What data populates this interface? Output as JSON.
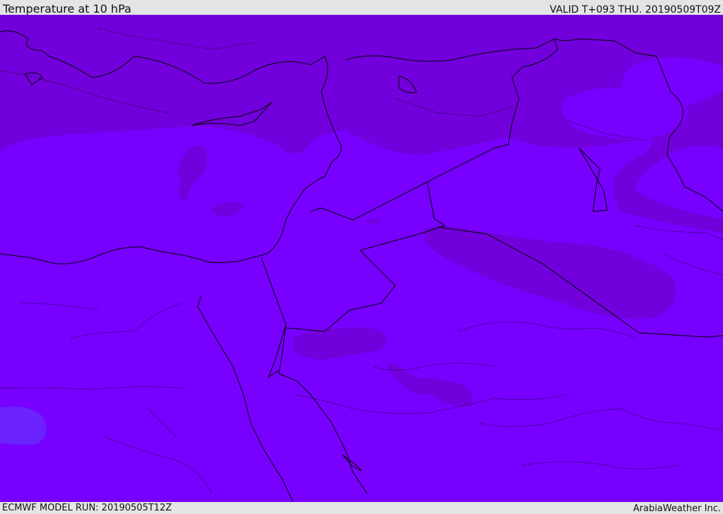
{
  "header": {
    "title": "Temperature at 10 hPa",
    "valid": "VALID T+093 THU. 20190509T09Z"
  },
  "footer": {
    "model_run": "ECMWF MODEL RUN: 20190505T12Z",
    "credit": "ArabiaWeather Inc."
  },
  "map": {
    "colors": {
      "base_field": "#7800ff",
      "warm_field": "#7200dc",
      "cool_field": "#6a22ff",
      "coastline": "#000000"
    },
    "legend": []
  }
}
